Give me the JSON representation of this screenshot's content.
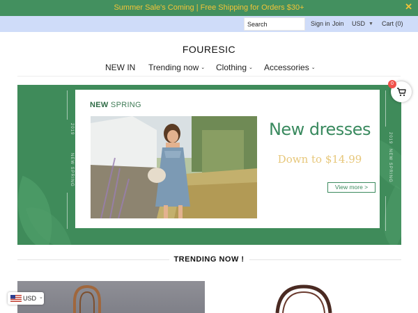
{
  "promo": {
    "text": "Summer Sale's Coming | Free Shipping for Orders $30+",
    "close": "✕"
  },
  "utility": {
    "search_value": "Search",
    "sign_in": "Sign in",
    "join": "Join",
    "currency": "USD",
    "cart": "Cart (0)"
  },
  "header": {
    "logo": "FOURESIC"
  },
  "nav": {
    "items": [
      {
        "label": "NEW IN",
        "has_dropdown": false
      },
      {
        "label": "Trending now",
        "has_dropdown": true
      },
      {
        "label": "Clothing",
        "has_dropdown": true
      },
      {
        "label": "Accessories",
        "has_dropdown": true
      }
    ]
  },
  "hero": {
    "tag_bold": "NEW",
    "tag_rest": " SPRING",
    "headline": "New dresses",
    "subline": "Down to $14.99",
    "cta": "View more >",
    "side_year": "2019",
    "side_text": "NEW SPRING",
    "colors": {
      "background": "#3f8b5a",
      "headline": "#3a8a5f",
      "price": "#e7c77a"
    }
  },
  "cart_widget": {
    "count": "0",
    "icon": "shopping-cart-icon"
  },
  "trending": {
    "title": "TRENDING NOW !"
  },
  "currency_switcher": {
    "code": "USD",
    "icon": "us-flag-icon"
  },
  "colors": {
    "promo_bg": "#43905f",
    "promo_text": "#f2c338",
    "utility_bg": "#cfdcf9"
  }
}
